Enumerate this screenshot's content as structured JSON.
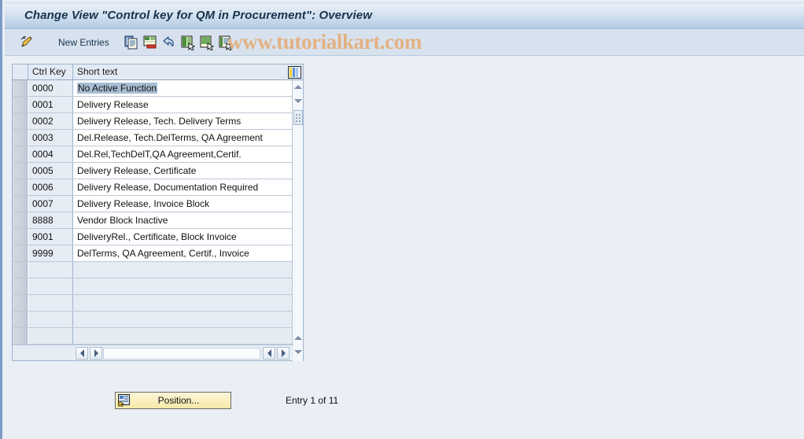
{
  "window": {
    "title": "Change View \"Control key for QM in Procurement\": Overview"
  },
  "toolbar": {
    "new_entries_label": "New Entries",
    "icons": [
      {
        "name": "edit-pencil-icon"
      },
      {
        "name": "copy-icon"
      },
      {
        "name": "delete-icon"
      },
      {
        "name": "undo-icon"
      },
      {
        "name": "select-all-icon"
      },
      {
        "name": "deselect-all-icon"
      },
      {
        "name": "select-block-icon"
      }
    ]
  },
  "watermark": {
    "text": "www.tutorialkart.com",
    "color": "#e3b183"
  },
  "table": {
    "columns": [
      "Ctrl Key",
      "Short text"
    ],
    "settings_icon": "table-settings-icon",
    "rows": [
      {
        "key": "0000",
        "text": "No Active Function",
        "selected": true
      },
      {
        "key": "0001",
        "text": "Delivery Release",
        "selected": false
      },
      {
        "key": "0002",
        "text": "Delivery Release, Tech. Delivery Terms",
        "selected": false
      },
      {
        "key": "0003",
        "text": "Del.Release, Tech.DelTerms, QA Agreement",
        "selected": false
      },
      {
        "key": "0004",
        "text": "Del.Rel,TechDelT,QA Agreement,Certif.",
        "selected": false
      },
      {
        "key": "0005",
        "text": "Delivery Release, Certificate",
        "selected": false
      },
      {
        "key": "0006",
        "text": "Delivery Release, Documentation Required",
        "selected": false
      },
      {
        "key": "0007",
        "text": "Delivery Release, Invoice Block",
        "selected": false
      },
      {
        "key": "8888",
        "text": "Vendor Block Inactive",
        "selected": false
      },
      {
        "key": "9001",
        "text": "DeliveryRel., Certificate, Block Invoice",
        "selected": false
      },
      {
        "key": "9999",
        "text": "DelTerms, QA Agreement, Certif., Invoice",
        "selected": false
      }
    ],
    "empty_row_count": 5
  },
  "footer": {
    "position_button_label": "Position...",
    "position_button_icon": "position-icon",
    "entry_status": "Entry 1 of 11"
  },
  "colors": {
    "titlebar_top": "#e8eff7",
    "titlebar_bottom": "#b4cce3",
    "toolbar_bg": "#d7e2ee",
    "page_bg": "#eaeff6",
    "selection": "#a8bdd4",
    "button_yellow": "#f6e9a8"
  }
}
